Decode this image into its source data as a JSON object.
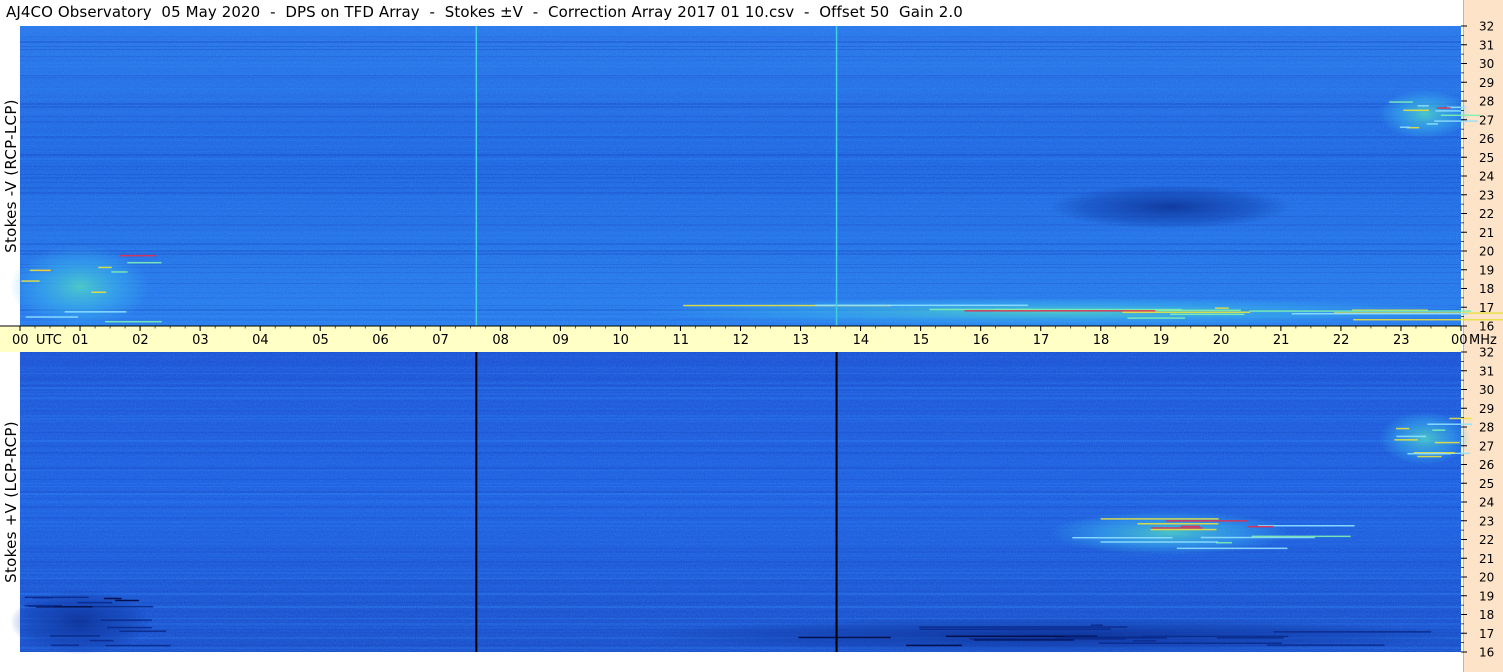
{
  "title": "AJ4CO Observatory  05 May 2020  -  DPS on TFD Array  -  Stokes ±V  -  Correction Array 2017 01 10.csv  -  Offset 50  Gain 2.0",
  "colors": {
    "background": "#ffffff",
    "freq_strip": "#fde3c8",
    "time_axis_band": "#ffffc6",
    "spectrogram_base": "#1e64e6",
    "spectrogram_dark": "#0a2a8c",
    "spectrogram_light": "#3aa6f0",
    "hot_yellow": "#e8e040",
    "hot_red": "#e03050",
    "cursor_cyan": "#40d0e0",
    "cursor_black": "#000000"
  },
  "chart_data": [
    {
      "type": "heatmap",
      "panel": "top",
      "ylabel": "Stokes -V  (RCP-LCP)",
      "x_unit": "UTC",
      "x_ticks": [
        "00",
        "01",
        "02",
        "03",
        "04",
        "05",
        "06",
        "07",
        "08",
        "09",
        "10",
        "11",
        "12",
        "13",
        "14",
        "15",
        "16",
        "17",
        "18",
        "19",
        "20",
        "21",
        "22",
        "23",
        "00"
      ],
      "xlim": [
        0,
        24
      ],
      "y_unit": "MHz",
      "y_ticks": [
        "16",
        "17",
        "18",
        "19",
        "20",
        "21",
        "22",
        "23",
        "24",
        "25",
        "26",
        "27",
        "28",
        "29",
        "30",
        "31",
        "32"
      ],
      "ylim": [
        16,
        32
      ],
      "cursor_lines_utc": [
        7.6,
        13.6
      ],
      "cursor_color": "cyan",
      "features": [
        {
          "utc_start": 0.0,
          "utc_end": 2.0,
          "mhz_start": 16.2,
          "mhz_end": 20.0,
          "intensity": "high"
        },
        {
          "utc_start": 17.3,
          "utc_end": 21.0,
          "mhz_start": 21.5,
          "mhz_end": 23.2,
          "intensity": "low"
        },
        {
          "utc_start": 10.5,
          "utc_end": 24.0,
          "mhz_start": 16.3,
          "mhz_end": 17.2,
          "intensity": "high"
        },
        {
          "utc_start": 22.8,
          "utc_end": 24.0,
          "mhz_start": 26.3,
          "mhz_end": 28.3,
          "intensity": "mixed"
        }
      ]
    },
    {
      "type": "heatmap",
      "panel": "bottom",
      "ylabel": "Stokes +V  (LCP-RCP)",
      "x_unit": "UTC",
      "x_ticks": [
        "00",
        "01",
        "02",
        "03",
        "04",
        "05",
        "06",
        "07",
        "08",
        "09",
        "10",
        "11",
        "12",
        "13",
        "14",
        "15",
        "16",
        "17",
        "18",
        "19",
        "20",
        "21",
        "22",
        "23",
        "00"
      ],
      "xlim": [
        0,
        24
      ],
      "y_unit": "MHz",
      "y_ticks": [
        "16",
        "17",
        "18",
        "19",
        "20",
        "21",
        "22",
        "23",
        "24",
        "25",
        "26",
        "27",
        "28",
        "29",
        "30",
        "31",
        "32"
      ],
      "ylim": [
        16,
        32
      ],
      "cursor_lines_utc": [
        7.6,
        13.6
      ],
      "cursor_color": "black",
      "features": [
        {
          "utc_start": 0.0,
          "utc_end": 2.0,
          "mhz_start": 16.2,
          "mhz_end": 19.0,
          "intensity": "low"
        },
        {
          "utc_start": 17.3,
          "utc_end": 21.0,
          "mhz_start": 21.5,
          "mhz_end": 23.2,
          "intensity": "high"
        },
        {
          "utc_start": 10.5,
          "utc_end": 24.0,
          "mhz_start": 16.3,
          "mhz_end": 17.5,
          "intensity": "low"
        },
        {
          "utc_start": 22.8,
          "utc_end": 24.0,
          "mhz_start": 26.3,
          "mhz_end": 28.5,
          "intensity": "high"
        }
      ]
    }
  ],
  "time_axis": {
    "labels": [
      "00",
      "01",
      "02",
      "03",
      "04",
      "05",
      "06",
      "07",
      "08",
      "09",
      "10",
      "11",
      "12",
      "13",
      "14",
      "15",
      "16",
      "17",
      "18",
      "19",
      "20",
      "21",
      "22",
      "23",
      "00"
    ],
    "utc_label": "UTC",
    "mhz_label": "MHz"
  }
}
